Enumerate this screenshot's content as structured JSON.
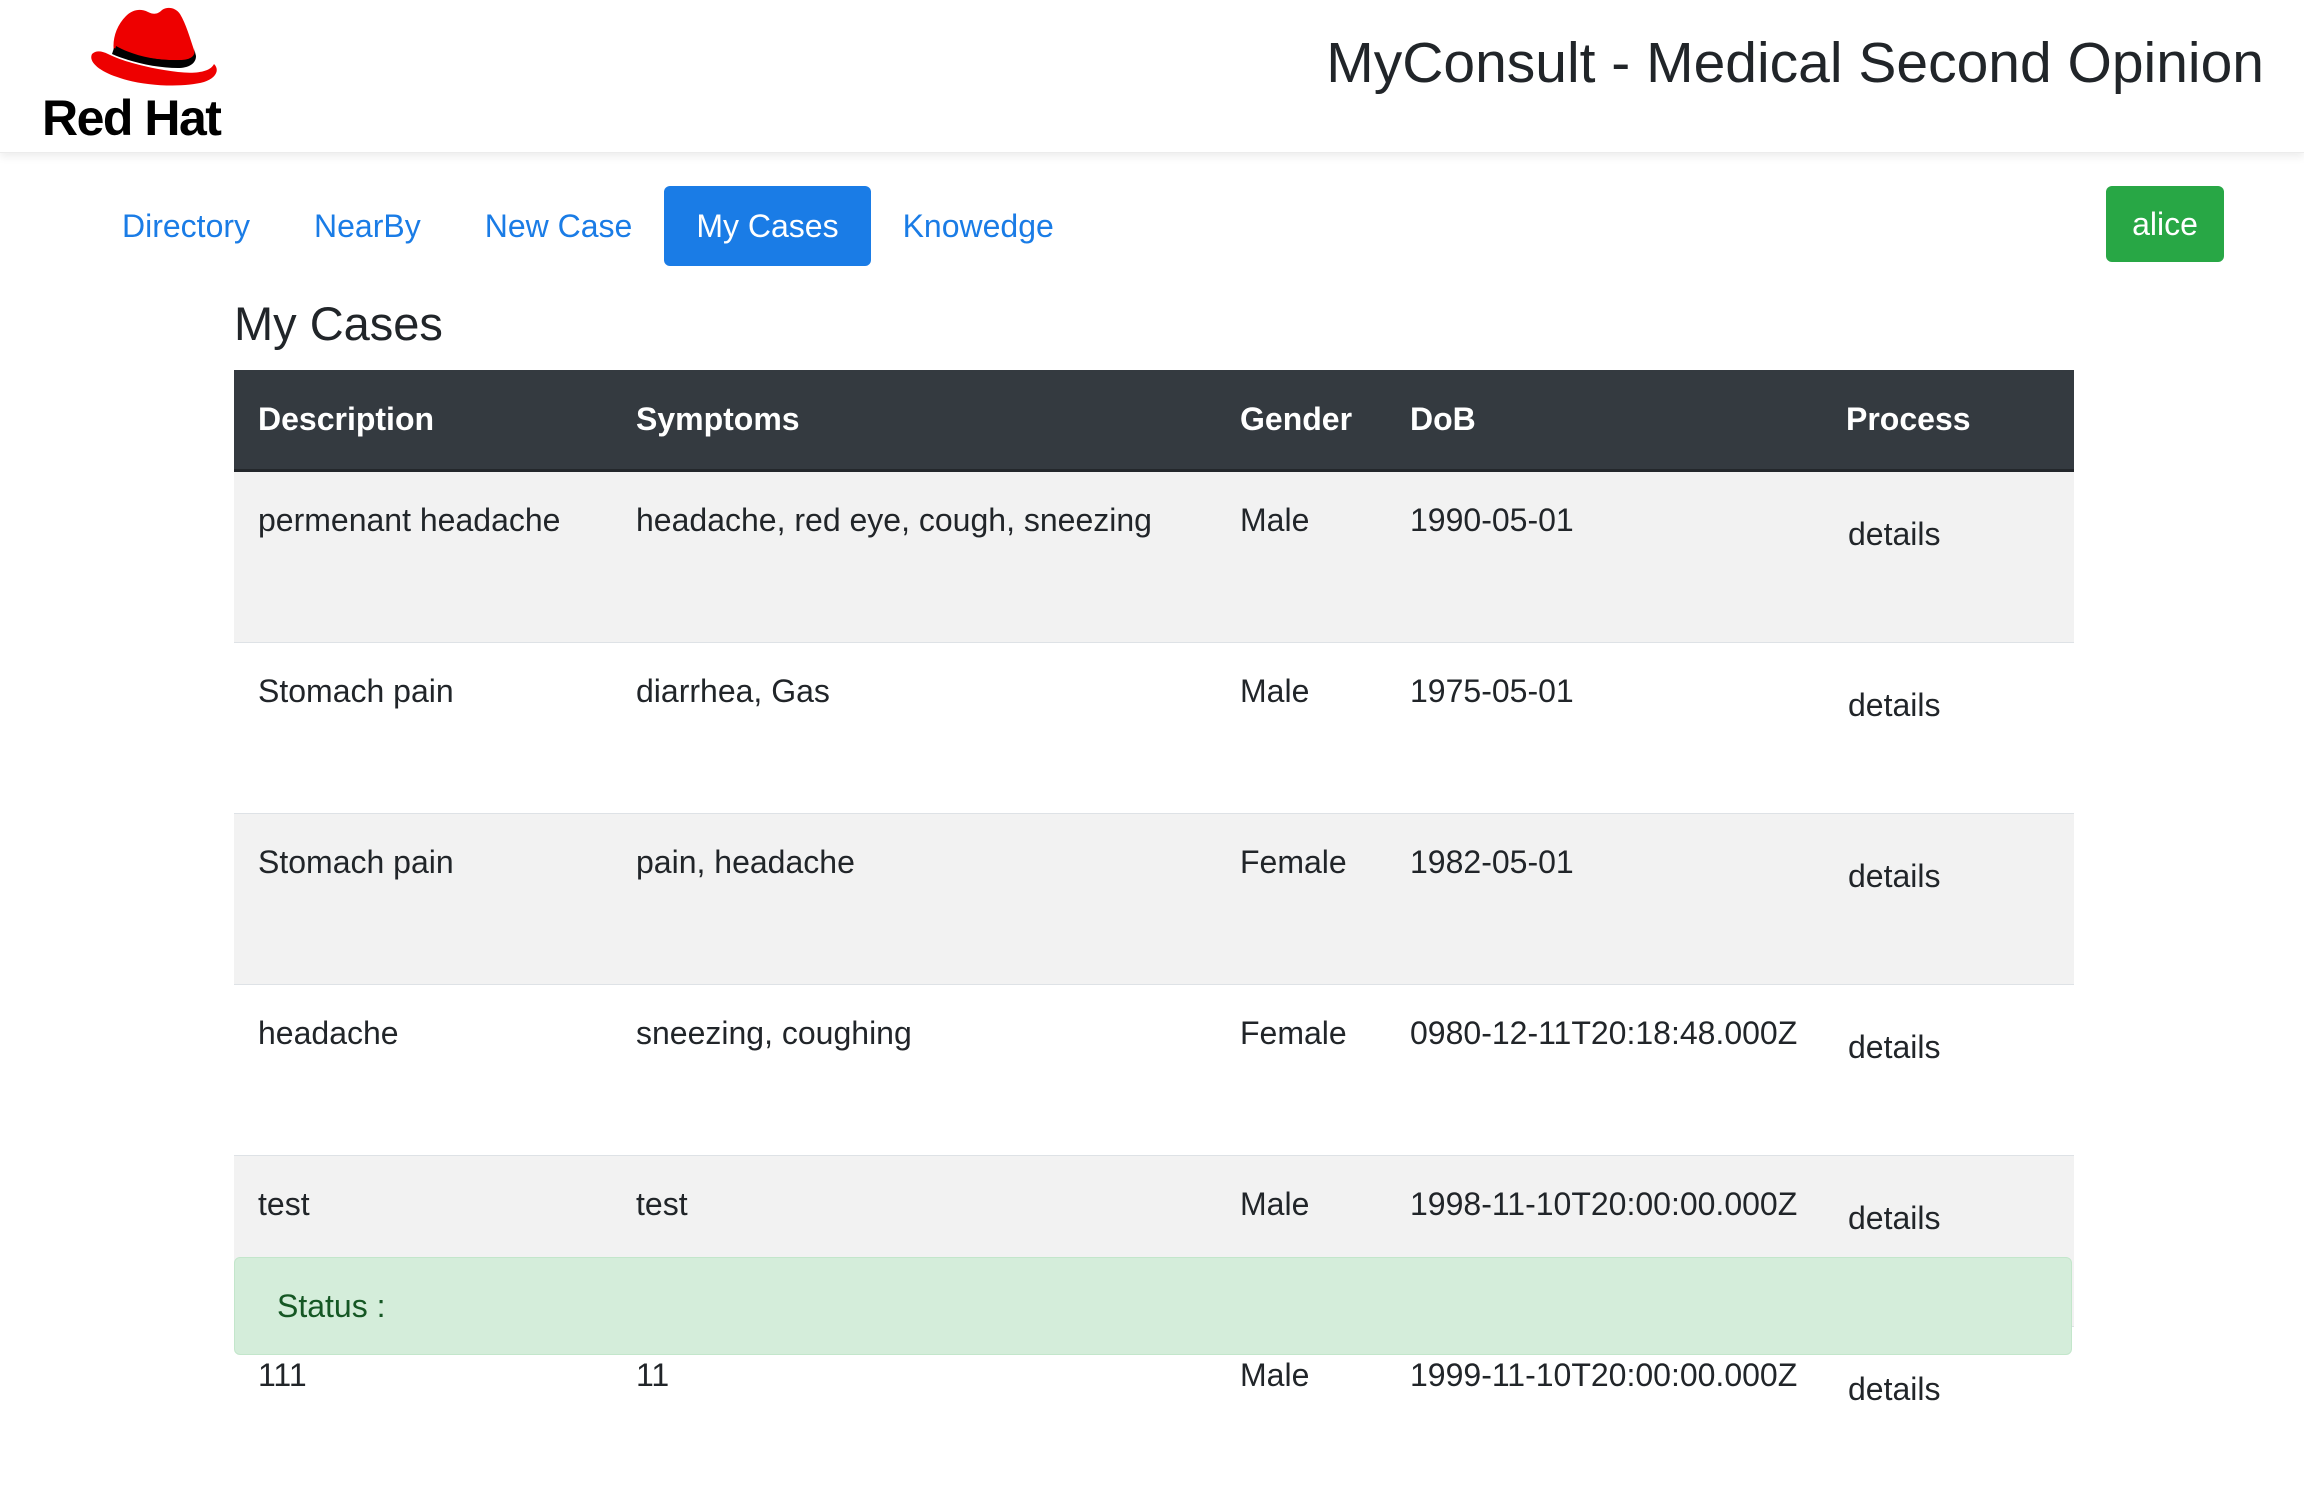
{
  "header": {
    "logo_text": "Red Hat",
    "title": "MyConsult - Medical Second Opinion"
  },
  "nav": {
    "items": [
      {
        "label": "Directory",
        "active": false
      },
      {
        "label": "NearBy",
        "active": false
      },
      {
        "label": "New Case",
        "active": false
      },
      {
        "label": "My Cases",
        "active": true
      },
      {
        "label": "Knowedge",
        "active": false
      }
    ],
    "user": "alice"
  },
  "page": {
    "title": "My Cases"
  },
  "table": {
    "columns": [
      "Description",
      "Symptoms",
      "Gender",
      "DoB",
      "Process"
    ],
    "rows": [
      {
        "description": "permenant headache",
        "symptoms": "headache, red eye, cough, sneezing",
        "gender": "Male",
        "dob": "1990-05-01",
        "process": "details"
      },
      {
        "description": "Stomach pain",
        "symptoms": "diarrhea, Gas",
        "gender": "Male",
        "dob": "1975-05-01",
        "process": "details"
      },
      {
        "description": "Stomach pain",
        "symptoms": "pain, headache",
        "gender": "Female",
        "dob": "1982-05-01",
        "process": "details"
      },
      {
        "description": "headache",
        "symptoms": "sneezing, coughing",
        "gender": "Female",
        "dob": "0980-12-11T20:18:48.000Z",
        "process": "details"
      },
      {
        "description": "test",
        "symptoms": "test",
        "gender": "Male",
        "dob": "1998-11-10T20:00:00.000Z",
        "process": "details"
      },
      {
        "description": "111",
        "symptoms": "11",
        "gender": "Male",
        "dob": "1999-11-10T20:00:00.000Z",
        "process": "details"
      }
    ]
  },
  "status": {
    "label": "Status :"
  },
  "colors": {
    "primary": "#1a7ce6",
    "success": "#28a745",
    "table_header": "#343a40",
    "status_bg": "#d4edda",
    "brand_red": "#ee0000"
  },
  "icons": {
    "logo": "red-hat-fedora-icon"
  }
}
